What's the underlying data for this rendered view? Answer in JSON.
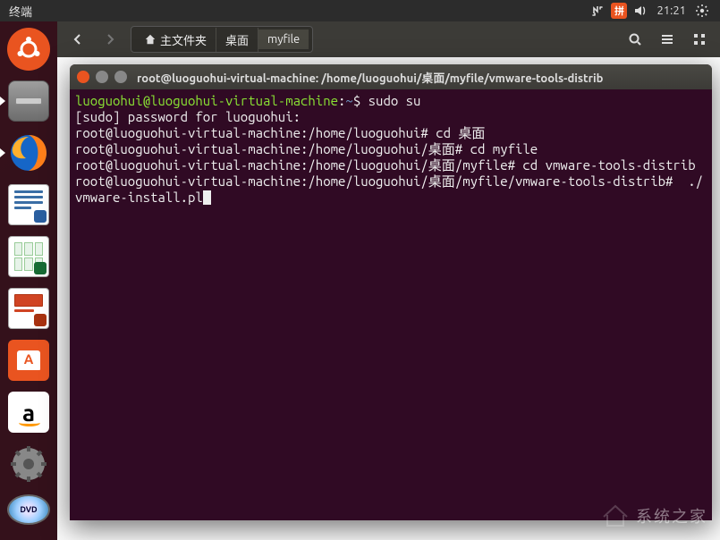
{
  "top_panel": {
    "active_app": "终端",
    "clock": "21:21",
    "ime_label": "拼"
  },
  "file_manager": {
    "home_label": "主文件夹",
    "path_segments": [
      "桌面",
      "myfile"
    ]
  },
  "launcher": {
    "disc_label": "DVD"
  },
  "terminal": {
    "title": "root@luoguohui-virtual-machine: /home/luoguohui/桌面/myfile/vmware-tools-distrib",
    "lines": [
      {
        "type": "prompt_user",
        "user": "luoguohui",
        "host": "luoguohui-virtual-machine",
        "path": "~",
        "symbol": "$",
        "cmd": "sudo su"
      },
      {
        "type": "plain",
        "text": "[sudo] password for luoguohui: "
      },
      {
        "type": "prompt_root",
        "user": "root",
        "host": "luoguohui-virtual-machine",
        "path": "/home/luoguohui",
        "symbol": "#",
        "cmd": "cd 桌面"
      },
      {
        "type": "prompt_root",
        "user": "root",
        "host": "luoguohui-virtual-machine",
        "path": "/home/luoguohui/桌面",
        "symbol": "#",
        "cmd": "cd myfile"
      },
      {
        "type": "prompt_root",
        "user": "root",
        "host": "luoguohui-virtual-machine",
        "path": "/home/luoguohui/桌面/myfile",
        "symbol": "#",
        "cmd": "cd vmware-tools-distrib"
      },
      {
        "type": "prompt_root",
        "user": "root",
        "host": "luoguohui-virtual-machine",
        "path": "/home/luoguohui/桌面/myfile/vmware-tools-distrib",
        "symbol": "#",
        "cmd": " ./vmware-install.pl",
        "cursor": true
      }
    ]
  },
  "watermark": {
    "text": "系统之家"
  }
}
